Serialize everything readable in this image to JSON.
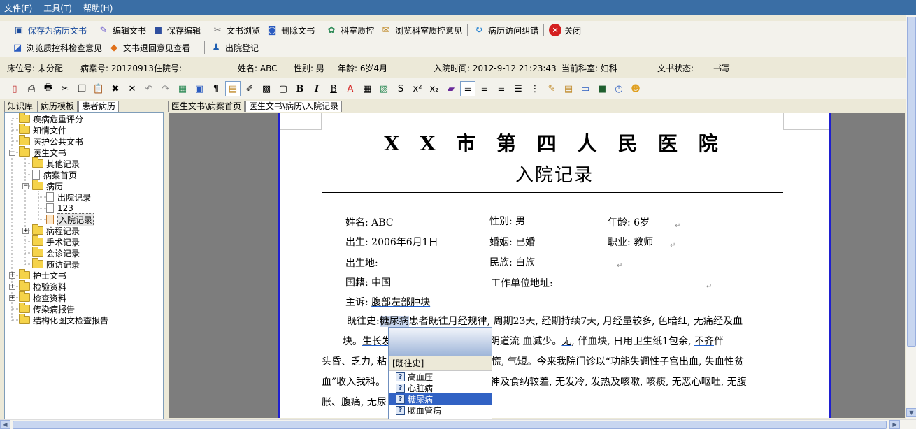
{
  "menu": [
    "文件(F)",
    "工具(T)",
    "帮助(H)"
  ],
  "toolbar": {
    "row1": [
      {
        "label": "保存为病历文书",
        "icon": "save-as-record-icon"
      },
      {
        "label": "编辑文书",
        "icon": "edit-document-icon"
      },
      {
        "label": "保存编辑",
        "icon": "floppy-save-icon"
      },
      {
        "label": "文书浏览",
        "icon": "browse-tools-icon"
      },
      {
        "label": "删除文书",
        "icon": "delete-document-icon"
      },
      {
        "label": "科室质控",
        "icon": "department-qc-icon"
      },
      {
        "label": "浏览科室质控意见",
        "icon": "qc-opinion-icon"
      },
      {
        "label": "病历访问纠错",
        "icon": "access-correction-icon"
      },
      {
        "label": "关闭",
        "icon": "close-red-icon"
      }
    ],
    "row2": [
      {
        "label": "浏览质控科检查意见",
        "icon": "qc-inspection-icon"
      },
      {
        "label": "文书退回意见查看",
        "icon": "return-opinion-icon"
      },
      {
        "label": "出院登记",
        "icon": "discharge-register-icon"
      }
    ]
  },
  "patient": {
    "bed": "床位号: 未分配",
    "case_no": "病案号: 20120913",
    "inpatient_no": "住院号:",
    "name": "姓名: ABC",
    "sex": "性别:  男",
    "age": "年龄: 6岁4月",
    "admit_time": "入院时间:  2012-9-12 21:23:43",
    "department": "当前科室: 妇科",
    "doc_status_label": "文书状态:",
    "doc_status": "书写"
  },
  "left_tabs": [
    "知识库",
    "病历模板",
    "患者病历"
  ],
  "doc_tabs": [
    "医生文书\\病案首页",
    "医生文书\\病历\\入院记录"
  ],
  "tree": [
    {
      "label": "疾病危重评分",
      "kind": "folder",
      "level": 1
    },
    {
      "label": "知情文件",
      "kind": "folder",
      "level": 1
    },
    {
      "label": "医护公共文书",
      "kind": "folder",
      "level": 1
    },
    {
      "label": "医生文书",
      "kind": "folder",
      "level": 1,
      "expander": "−"
    },
    {
      "label": "其他记录",
      "kind": "folder",
      "level": 2
    },
    {
      "label": "病案首页",
      "kind": "doc",
      "level": 2
    },
    {
      "label": "病历",
      "kind": "folder",
      "level": 2,
      "expander": "−"
    },
    {
      "label": "出院记录",
      "kind": "doc",
      "level": 3
    },
    {
      "label": "123",
      "kind": "doc",
      "level": 3
    },
    {
      "label": "入院记录",
      "kind": "doc-edit",
      "level": 3,
      "selected": true
    },
    {
      "label": "病程记录",
      "kind": "folder",
      "level": 2,
      "expander": "+"
    },
    {
      "label": "手术记录",
      "kind": "folder",
      "level": 2
    },
    {
      "label": "会诊记录",
      "kind": "folder",
      "level": 2
    },
    {
      "label": "随访记录",
      "kind": "folder",
      "level": 2
    },
    {
      "label": "护士文书",
      "kind": "folder",
      "level": 1,
      "expander": "+"
    },
    {
      "label": "检验资料",
      "kind": "folder",
      "level": 1,
      "expander": "+"
    },
    {
      "label": "检查资料",
      "kind": "folder",
      "level": 1,
      "expander": "+"
    },
    {
      "label": "传染病报告",
      "kind": "folder",
      "level": 1
    },
    {
      "label": "结构化图文检查报告",
      "kind": "folder",
      "level": 1
    }
  ],
  "document": {
    "hospital": "X X 市  第 四 人 民 医 院",
    "title": "入院记录",
    "fields": {
      "name_label": "姓名:",
      "name": "ABC",
      "sex_label": "性别:",
      "sex": "男",
      "age_label": "年龄:",
      "age": "6岁",
      "birth_label": "出生:",
      "birth": "2006年6月1日",
      "marriage_label": "婚姻:",
      "marriage": "已婚",
      "job_label": "职业:",
      "job": "教师",
      "birthplace_label": "出生地:",
      "nation_label": "民族:",
      "nation": "白族",
      "nationality_label": "国籍:",
      "nationality": "中国",
      "workplace_label": "工作单位地址:",
      "complaint_label": "主诉:",
      "complaint": "腹部左部肿块"
    },
    "history": {
      "label": "既往史:",
      "highlight": "糖尿病",
      "l1_rest": "患者既往月经规律, 周期23天, 经期持续7天, 月经量较多, 色暗红, 无痛经及血",
      "l2_a": "块。",
      "l2_b": "生长发",
      "l2_c": "2天后阴道流  血减少。",
      "l2_d": "无",
      "l2_e": ", 伴血块, 日用卫生纸1包余, ",
      "l2_f": "不齐",
      "l2_g": "伴",
      "l3_a": "头昏、乏力, 粘",
      "l3_b": "心慌, 气短。今来我院门诊以“功能失调性子宫出血, 失血性贫",
      "l4_a": "血”收入我科。",
      "l4_b": "神及食纳较差, 无发冷, 发热及咳嗽, 咳痰, 无恶心呕吐, 无腹",
      "l5_a": "胀、腹痛, 无尿"
    }
  },
  "popup": {
    "category": "[既往史]",
    "items": [
      "高血压",
      "心脏病",
      "糖尿病",
      "脑血管病"
    ],
    "selected_index": 2
  },
  "colors": {
    "menubar": "#3a6ea5",
    "page_border": "#1f1fd0",
    "selection": "#3162c4"
  }
}
